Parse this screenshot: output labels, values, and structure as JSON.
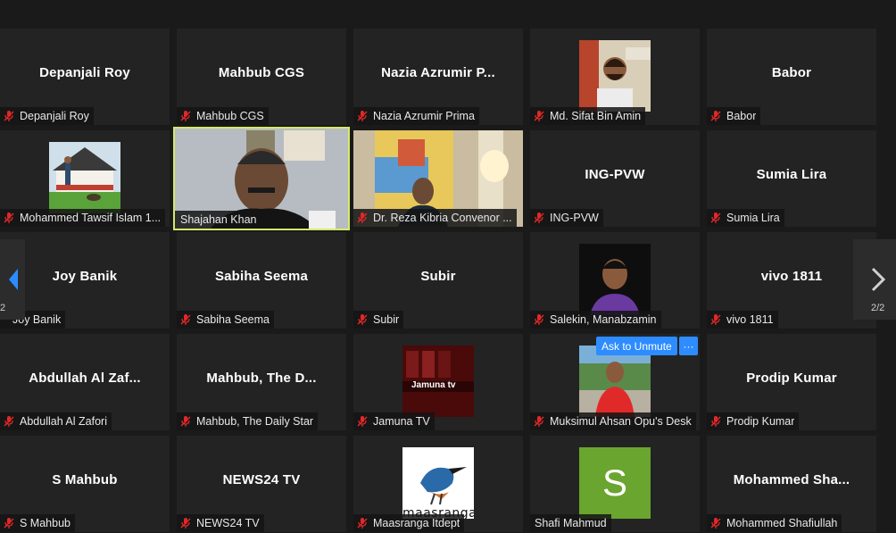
{
  "tiles": [
    {
      "name": "Depanjali Roy",
      "display": "Depanjali Roy",
      "muted": true
    },
    {
      "name": "Mahbub CGS",
      "display": "Mahbub CGS",
      "muted": true
    },
    {
      "name": "Nazia Azrumir Prima",
      "display": "Nazia Azrumir P...",
      "muted": true
    },
    {
      "name": "Md. Sifat Bin Amin",
      "muted": true
    },
    {
      "name": "Babor",
      "display": "Babor",
      "muted": true
    },
    {
      "name": "Mohammed Tawsif Islam 1...",
      "muted": true
    },
    {
      "name": "Shajahan Khan",
      "muted": false
    },
    {
      "name": "Dr. Reza Kibria Convenor ...",
      "muted": true
    },
    {
      "name": "ING-PVW",
      "display": "ING-PVW",
      "muted": true
    },
    {
      "name": "Sumia Lira",
      "display": "Sumia Lira",
      "muted": true
    },
    {
      "name": "Joy Banik",
      "display": "Joy Banik",
      "muted": false
    },
    {
      "name": "Sabiha Seema",
      "display": "Sabiha Seema",
      "muted": true
    },
    {
      "name": "Subir",
      "display": "Subir",
      "muted": true
    },
    {
      "name": "Salekin, Manabzamin",
      "muted": true
    },
    {
      "name": "vivo 1811",
      "display": "vivo 1811",
      "muted": true
    },
    {
      "name": "Abdullah Al Zafori",
      "display": "Abdullah Al Zaf...",
      "muted": true
    },
    {
      "name": "Mahbub, The Daily Star",
      "display": "Mahbub, The D...",
      "muted": true
    },
    {
      "name": "Jamuna TV",
      "muted": true,
      "logo_text": "Jamuna tv"
    },
    {
      "name": "Muksimul Ahsan Opu's Desk",
      "muted": false
    },
    {
      "name": "Prodip Kumar",
      "display": "Prodip Kumar",
      "muted": true
    },
    {
      "name": "S Mahbub",
      "display": "S Mahbub",
      "muted": true
    },
    {
      "name": "NEWS24 TV",
      "display": "NEWS24 TV",
      "muted": true
    },
    {
      "name": "Maasranga Itdept",
      "muted": true,
      "logo_text": "maasranga"
    },
    {
      "name": "Shafi Mahmud",
      "muted": false,
      "avatar_letter": "S"
    },
    {
      "name": "Mohammed Shafiullah",
      "display": "Mohammed Sha...",
      "muted": true
    }
  ],
  "pager": {
    "left": "2",
    "right": "2/2"
  },
  "unmute": {
    "label": "Ask to Unmute",
    "more": "···"
  },
  "colors": {
    "background": "#1a1a1a",
    "tile": "#232323",
    "active_border": "#d6e86a",
    "accent": "#2d8cff",
    "mic_muted": "#e02828",
    "avatar_green": "#6aa52f"
  }
}
